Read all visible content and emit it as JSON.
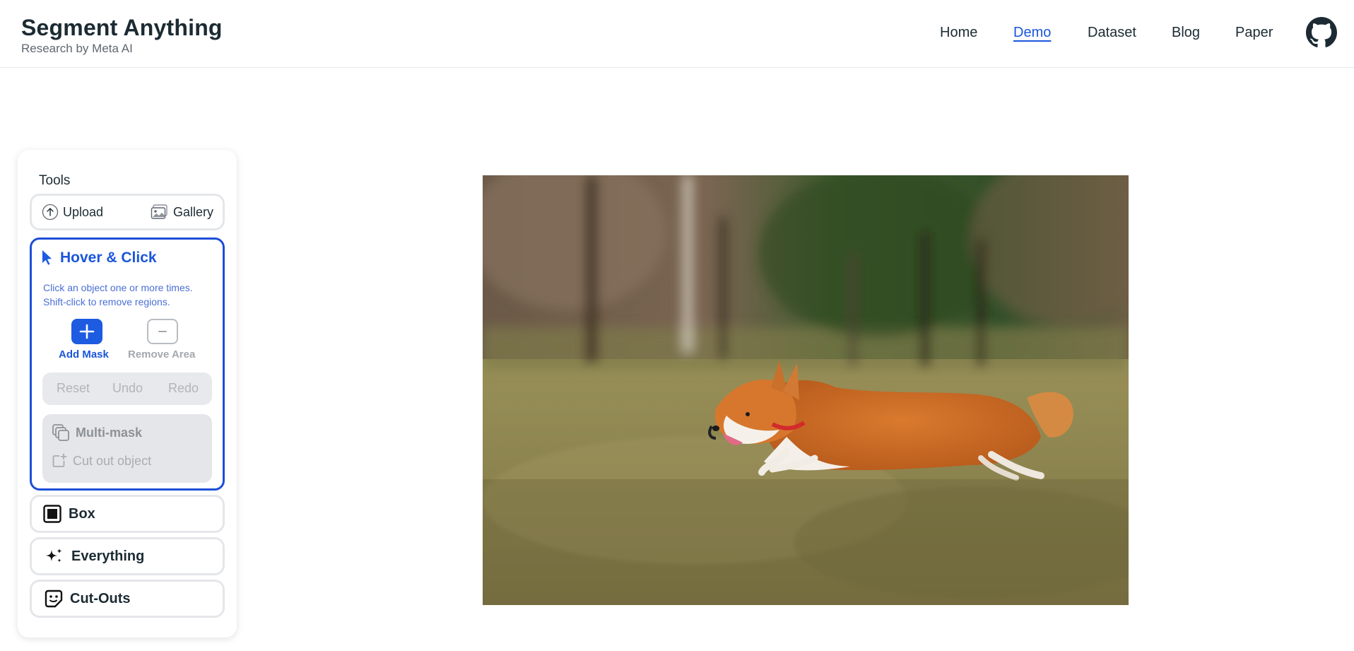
{
  "header": {
    "title": "Segment Anything",
    "subtitle": "Research by Meta AI",
    "nav": [
      {
        "label": "Home"
      },
      {
        "label": "Demo",
        "active": true
      },
      {
        "label": "Dataset"
      },
      {
        "label": "Blog"
      },
      {
        "label": "Paper"
      }
    ],
    "github_icon": "github-icon"
  },
  "tools": {
    "title": "Tools",
    "upload_label": "Upload",
    "gallery_label": "Gallery",
    "hover_click": {
      "title": "Hover & Click",
      "description_line1": "Click an object one or more times.",
      "description_line2": "Shift-click to remove regions.",
      "add_mask_label": "Add Mask",
      "remove_area_label": "Remove Area",
      "reset_label": "Reset",
      "undo_label": "Undo",
      "redo_label": "Redo",
      "multi_mask_label": "Multi-mask",
      "cut_out_label": "Cut out object"
    },
    "box_label": "Box",
    "everything_label": "Everything",
    "cutouts_label": "Cut-Outs"
  },
  "colors": {
    "accent": "#1a56db",
    "active_border": "#1d4ed8",
    "disabled_text": "#b1b5ba"
  },
  "image": {
    "subject": "corgi running on grass"
  }
}
